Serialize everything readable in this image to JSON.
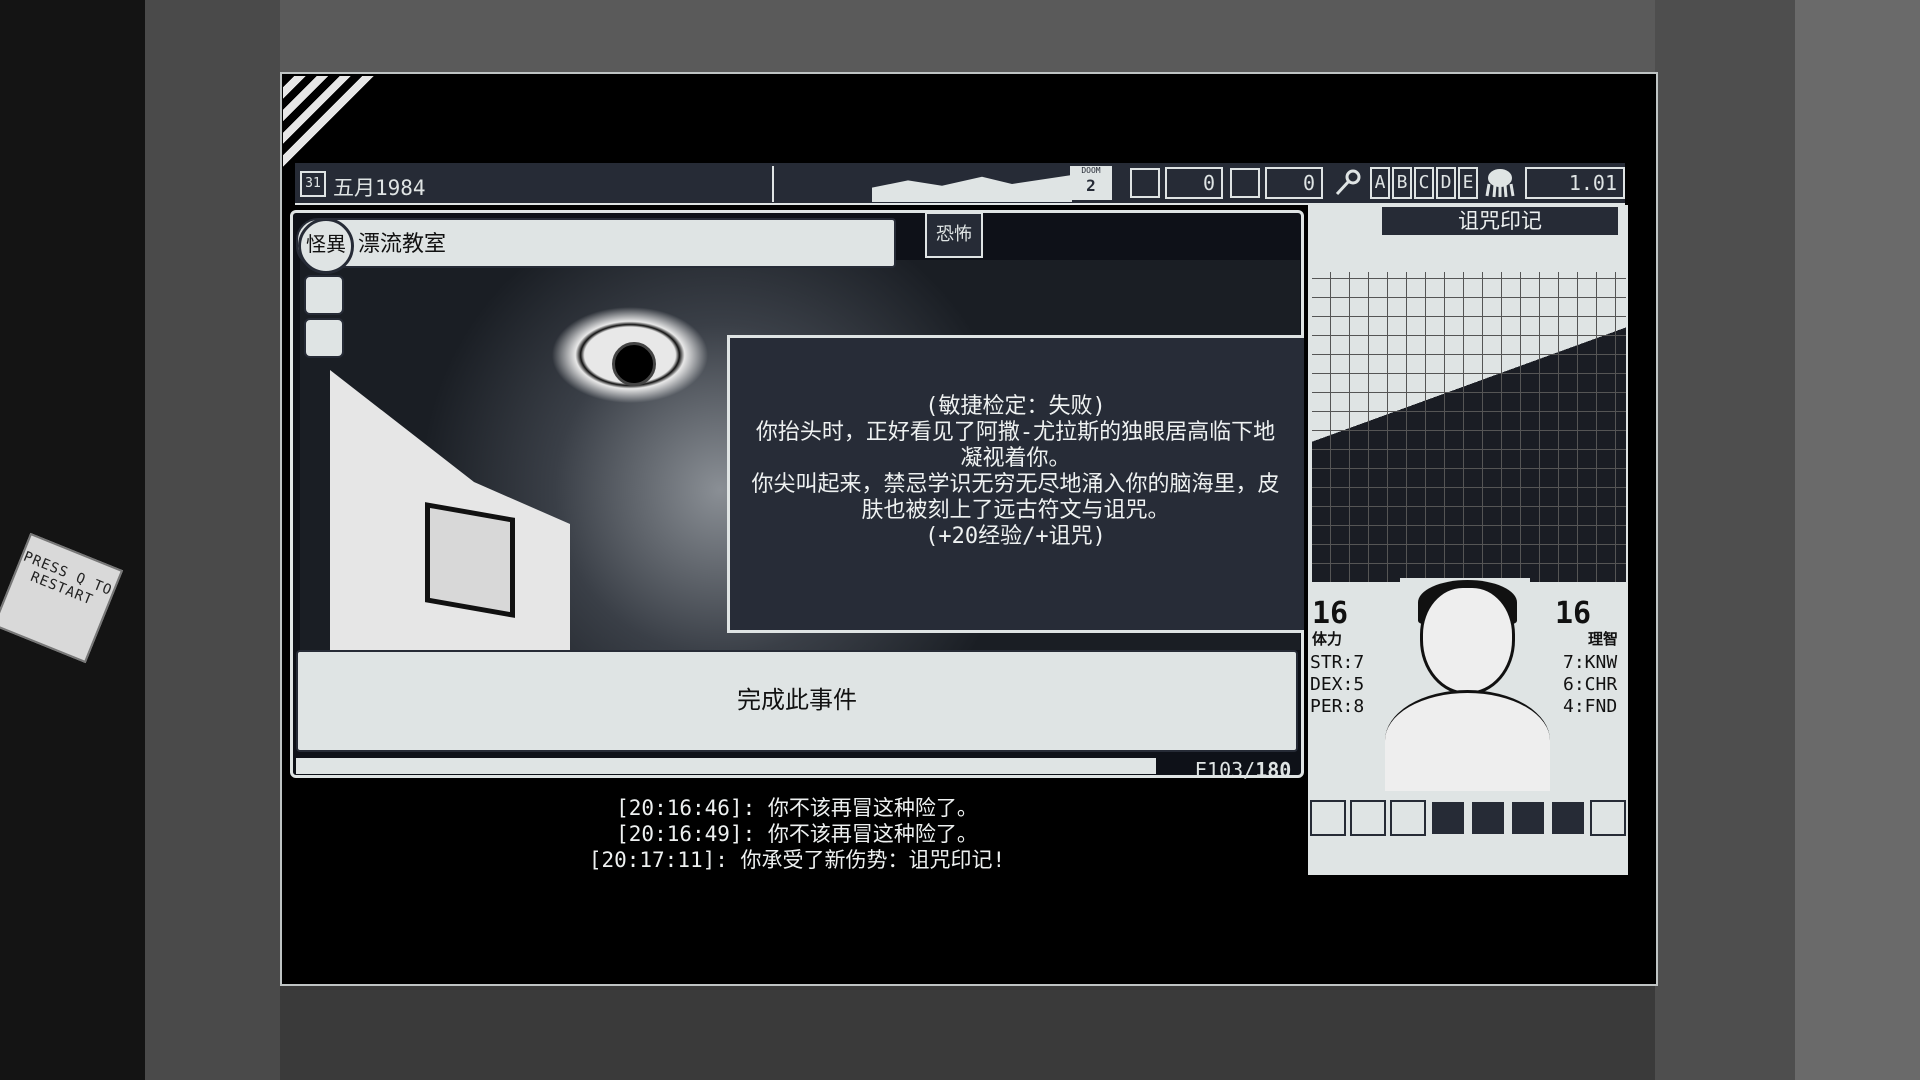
{
  "top_bar": {
    "day": "31",
    "date": "五月1984",
    "doom_label": "DOOM",
    "doom_value": "2",
    "counter_a": "0",
    "counter_b": "0",
    "letters": [
      "A",
      "B",
      "C",
      "D",
      "E"
    ],
    "value": "1.01"
  },
  "event": {
    "badge": "怪異",
    "title": "漂流教室",
    "tag": "恐怖",
    "dialog_lines": [
      "(敏捷检定：失败)",
      "你抬头时，正好看见了阿撒-尤拉斯的独眼居高临下地",
      "凝视着你。",
      "你尖叫起来，禁忌学识无穷无尽地涌入你的脑海里，皮",
      "肤也被刻上了远古符文与诅咒。",
      "(+20经验/+诅咒)"
    ],
    "complete_button": "完成此事件",
    "exp": "E103/",
    "exp_max": "180"
  },
  "log": [
    "[20:16:46]: 你不该再冒这种险了。",
    "[20:16:49]: 你不该再冒这种险了。",
    "[20:17:11]: 你承受了新伤势：诅咒印记!"
  ],
  "character": {
    "panel_title": "诅咒印记",
    "stamina": "16",
    "stamina_label": "体力",
    "reason": "16",
    "reason_label": "理智",
    "left_stats": [
      "STR:7",
      "DEX:5",
      "PER:8"
    ],
    "right_stats": [
      "7:KNW",
      "6:CHR",
      "4:FND"
    ]
  },
  "sticky_note": "PRESS Q TO RESTART"
}
